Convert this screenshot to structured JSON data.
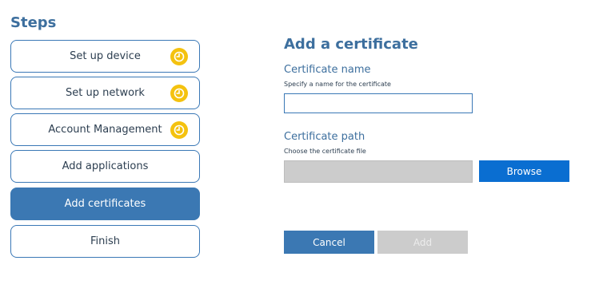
{
  "steps": {
    "title": "Steps",
    "items": [
      {
        "label": "Set up device",
        "status_icon": "clock-icon",
        "active": false
      },
      {
        "label": "Set up network",
        "status_icon": "clock-icon",
        "active": false
      },
      {
        "label": "Account Management",
        "status_icon": "clock-icon",
        "active": false
      },
      {
        "label": "Add applications",
        "status_icon": "",
        "active": false
      },
      {
        "label": "Add certificates",
        "status_icon": "",
        "active": true
      },
      {
        "label": "Finish",
        "status_icon": "",
        "active": false
      }
    ]
  },
  "form": {
    "title": "Add a certificate",
    "name_field": {
      "label": "Certificate name",
      "hint": "Specify a name for the certificate",
      "value": "",
      "placeholder": ""
    },
    "path_field": {
      "label": "Certificate path",
      "hint": "Choose the certificate file",
      "value": ""
    },
    "browse_label": "Browse",
    "cancel_label": "Cancel",
    "add_label": "Add"
  },
  "colors": {
    "accent": "#3b78b3",
    "title": "#3d6f9e",
    "browse": "#0a6ed1",
    "pending": "#f4c20f",
    "disabled": "#cccccc"
  }
}
